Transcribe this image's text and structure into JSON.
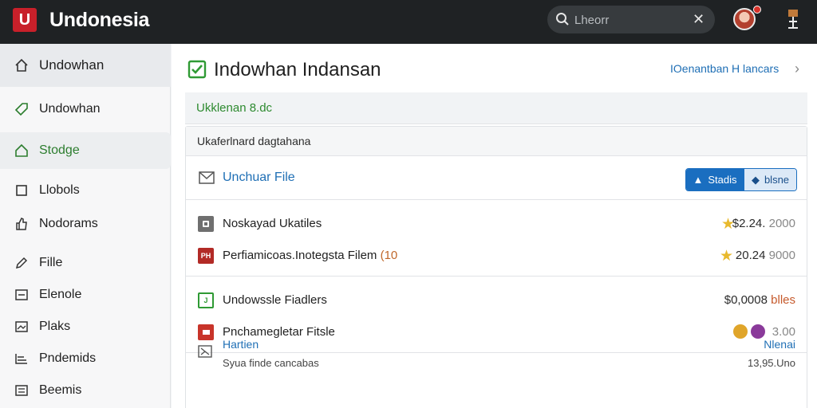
{
  "header": {
    "logo_letter": "U",
    "app_title": "Undonesia",
    "search_placeholder": "Lheorr"
  },
  "sidebar": {
    "items": [
      {
        "label": "Undowhan",
        "icon": "home-icon"
      },
      {
        "label": "Undowhan",
        "icon": "tag-icon"
      },
      {
        "label": "Stodge",
        "icon": "house-outline-icon",
        "active": true
      },
      {
        "label": "Llobols",
        "icon": "square-icon"
      },
      {
        "label": "Nodorams",
        "icon": "thumbs-up-icon"
      },
      {
        "label": "Fille",
        "icon": "pen-icon"
      },
      {
        "label": "Elenole",
        "icon": "chat-box-icon"
      },
      {
        "label": "Plaks",
        "icon": "image-icon"
      },
      {
        "label": "Pndemids",
        "icon": "chart-icon"
      },
      {
        "label": "Beemis",
        "icon": "list-icon"
      }
    ]
  },
  "main": {
    "title": "Indowhan Indansan",
    "header_link": "IOenantban H lancars",
    "section_banner": "Ukklenan 8.dc",
    "card_header": "Ukaferlnard dagtahana",
    "file_row": {
      "label": "Unchuar File",
      "seg_left": "Stadis",
      "seg_right": "blsne"
    },
    "group1": [
      {
        "name": "Noskayad Ukatiles",
        "name_tail": "",
        "amount": "$2.24.",
        "amount_suffix": "2000"
      },
      {
        "name": "Perfiamicoas.Inotegsta Filem ",
        "name_tail": "(10",
        "amount": "20.24",
        "amount_suffix": "9000"
      }
    ],
    "group2": [
      {
        "name": "Undowssle Fiadlers",
        "amount": "$0,0008",
        "amount_suffix": "blles"
      },
      {
        "name": "Pnchamegletar Fitsle",
        "amount": "3.00",
        "amount_suffix": ""
      }
    ],
    "footer": {
      "title": "Hartien",
      "subtitle": "Syua finde cancabas",
      "right_title": "Nlenai",
      "right_value": "13,95.Uno"
    }
  },
  "colors": {
    "topbar": "#1f2224",
    "brand_red": "#c8202a",
    "accent_green": "#2c7d2e",
    "link_blue": "#1f6fb5"
  }
}
